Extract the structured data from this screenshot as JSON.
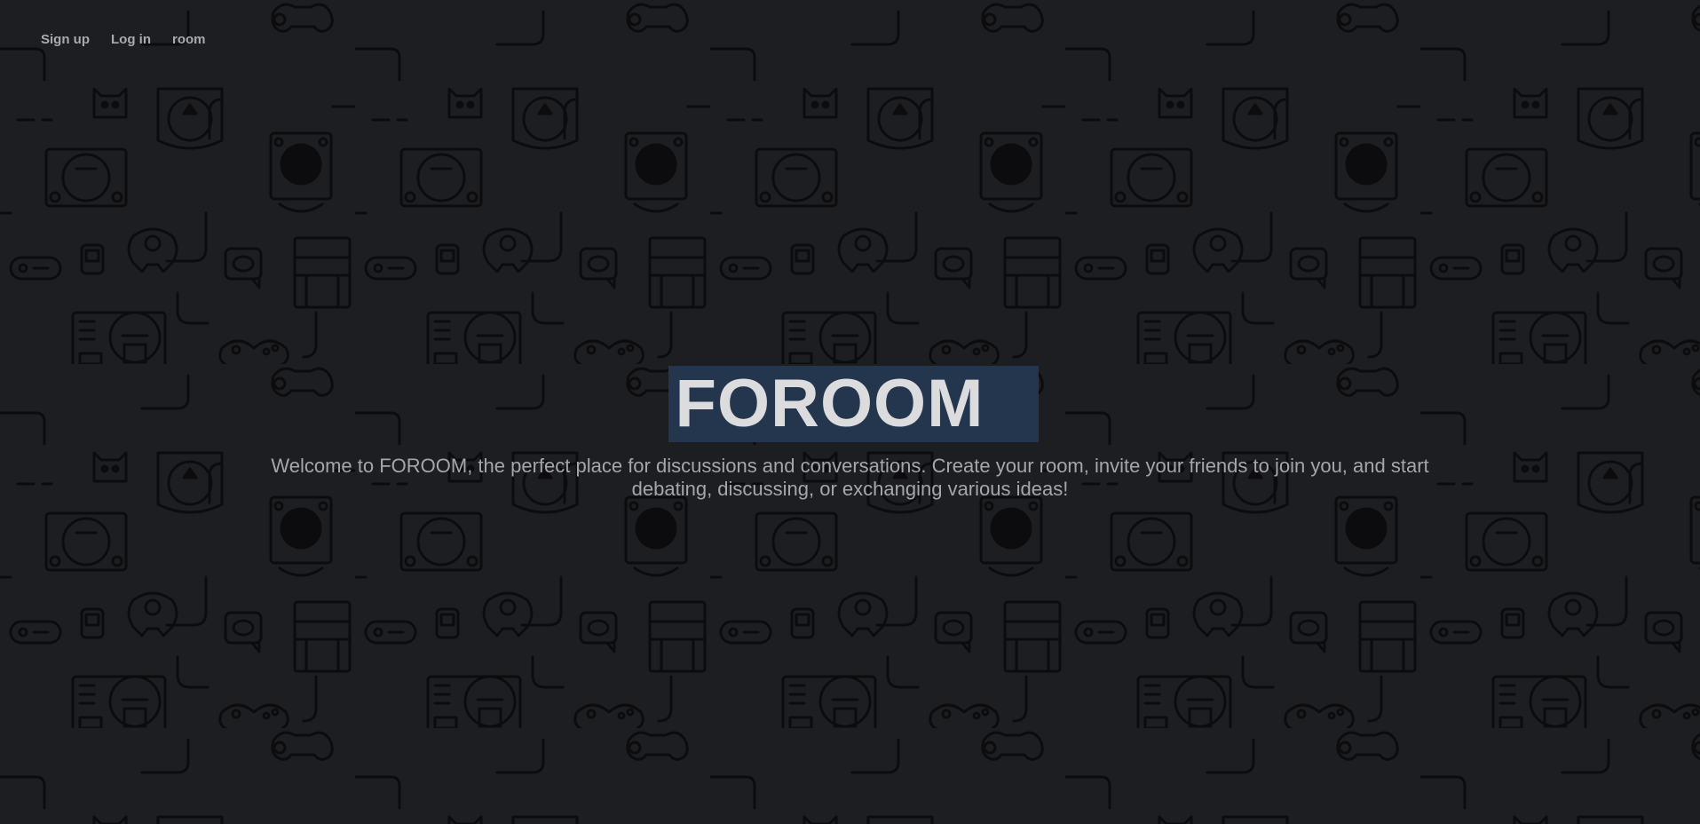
{
  "nav": {
    "items": [
      {
        "label": "Sign up"
      },
      {
        "label": "Log in"
      },
      {
        "label": "room"
      }
    ]
  },
  "hero": {
    "title": "FOROOM",
    "description": "Welcome to FOROOM, the perfect place for discussions and conversations. Create your room, invite your friends to join you, and start debating, discussing, or exchanging various ideas!"
  },
  "background": {
    "pattern_icons": [
      "gamepad-icon",
      "console-icon",
      "discord-icon",
      "cartridge-icon",
      "handheld-icon"
    ],
    "base_color": "#1d1e21",
    "line_color": "#0c0c0e"
  },
  "colors": {
    "title_highlight": "#23364d",
    "title_text": "#dcdcdf",
    "body_text": "#a5a6ab",
    "nav_text": "#a9aab0"
  }
}
